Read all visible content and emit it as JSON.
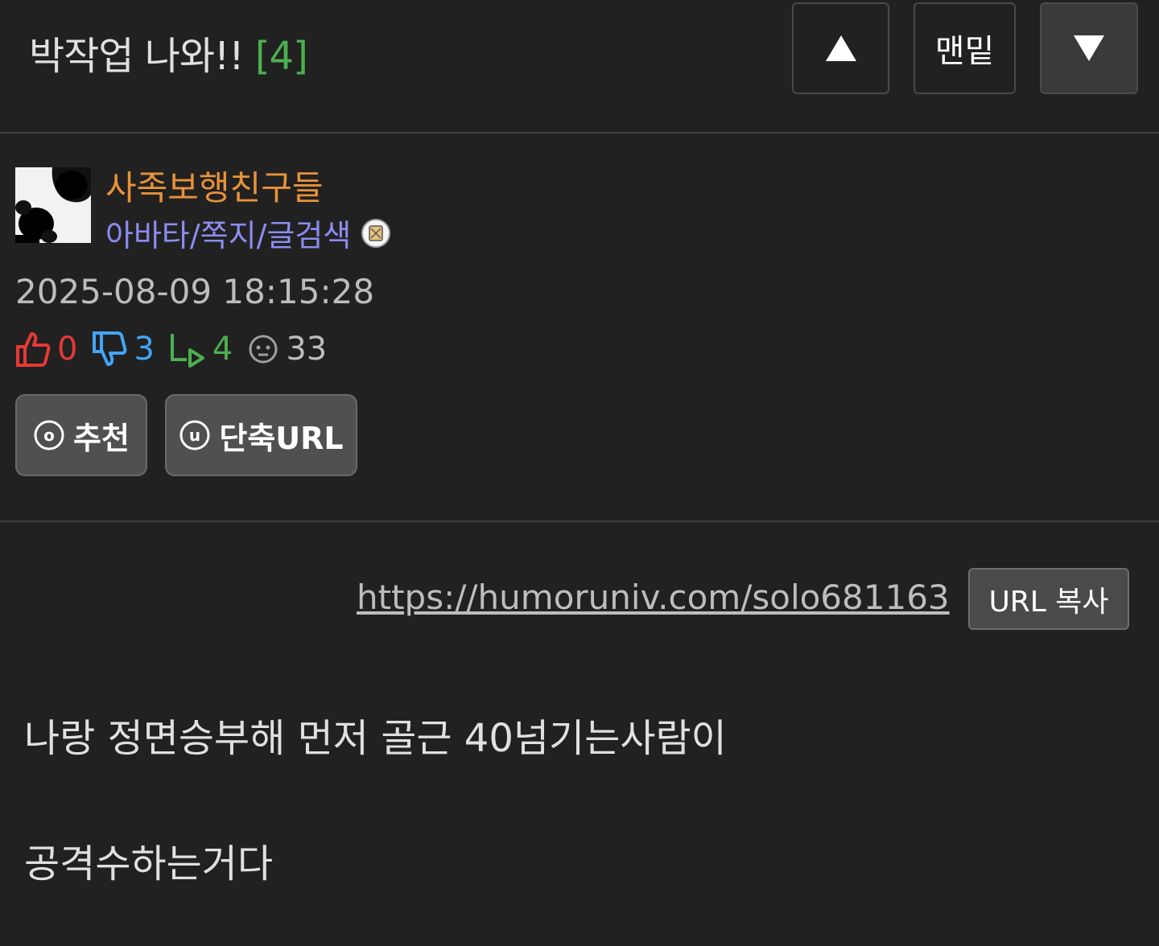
{
  "header": {
    "title": "박작업 나와!!",
    "comment_count": "[4]",
    "nav_up_label": "▲",
    "nav_bottom_label": "맨밑",
    "nav_down_label": "▼"
  },
  "author": {
    "name": "사족보행친구들",
    "links": "아바타/쪽지/글검색",
    "avatar_icon": "paw-print-avatar",
    "level_icon": "level-badge-icon"
  },
  "post": {
    "datetime": "2025-08-09 18:15:28",
    "stats": {
      "upvotes": "0",
      "downvotes": "3",
      "replies": "4",
      "views": "33"
    }
  },
  "actions": {
    "recommend_label": "추천",
    "recommend_glyph": "o",
    "shorturl_label": "단축URL",
    "shorturl_glyph": "u"
  },
  "content": {
    "url": "https://humoruniv.com/solo681163",
    "copy_label": "URL 복사",
    "lines": [
      "나랑 정면승부해 먼저 골근 40넘기는사람이",
      "공격수하는거다"
    ]
  },
  "colors": {
    "background": "#212121",
    "author_name": "#e8923a",
    "author_links": "#8c8cf0",
    "upvote": "#e53935",
    "downvote": "#42a5f5",
    "reply": "#4caf50",
    "comment_count": "#4caf50"
  }
}
